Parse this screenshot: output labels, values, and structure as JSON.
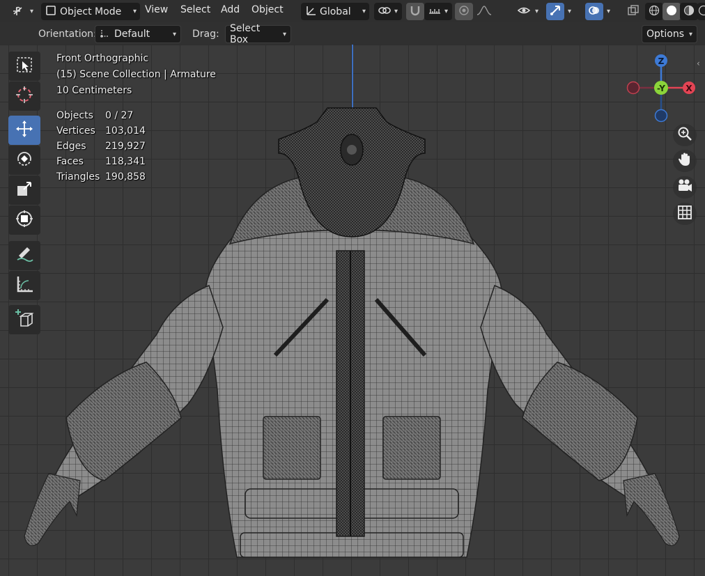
{
  "header": {
    "mode": "Object Mode",
    "menus": [
      "View",
      "Select",
      "Add",
      "Object"
    ],
    "transform_orientation": "Global"
  },
  "tool_settings": {
    "orientation_label": "Orientation:",
    "orientation_value": "Default",
    "drag_label": "Drag:",
    "drag_value": "Select Box",
    "options_label": "Options"
  },
  "viewport": {
    "view_name": "Front Orthographic",
    "collection": "(15) Scene Collection | Armature",
    "scale": "10 Centimeters",
    "stats": [
      {
        "label": "Objects",
        "value": "0 / 27"
      },
      {
        "label": "Vertices",
        "value": "103,014"
      },
      {
        "label": "Edges",
        "value": "219,927"
      },
      {
        "label": "Faces",
        "value": "118,341"
      },
      {
        "label": "Triangles",
        "value": "190,858"
      }
    ],
    "gizmo": {
      "z": "Z",
      "y": "-Y",
      "x": "X"
    }
  },
  "colors": {
    "accent_blue": "#4772b3",
    "axis_x": "#e44454",
    "axis_y": "#8bd43a",
    "axis_z": "#3d7ad6"
  },
  "tools": [
    "select-box",
    "cursor",
    "move",
    "rotate",
    "scale",
    "transform",
    "annotate",
    "measure",
    "add-cube"
  ]
}
